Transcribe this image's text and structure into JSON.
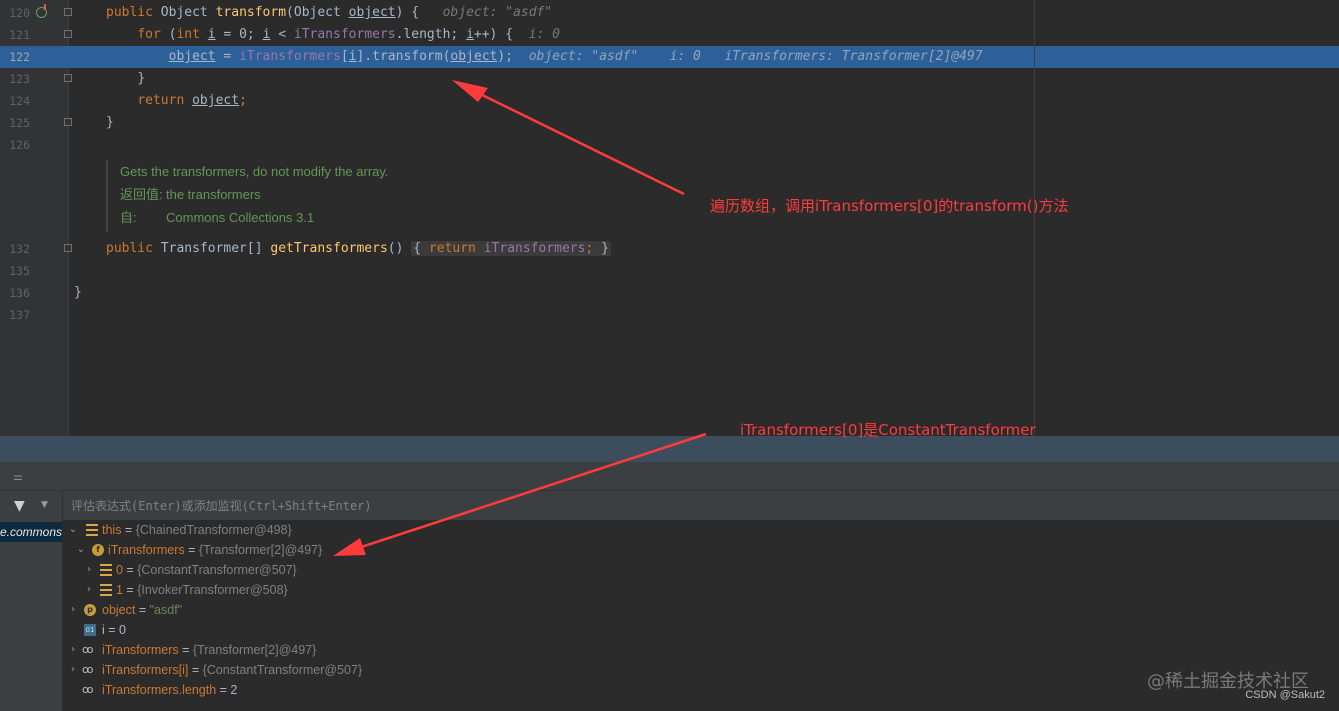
{
  "editor": {
    "lines": [
      {
        "num": "120",
        "cur": false
      },
      {
        "num": "121",
        "cur": false
      },
      {
        "num": "122",
        "cur": true
      },
      {
        "num": "123",
        "cur": false
      },
      {
        "num": "124",
        "cur": false
      },
      {
        "num": "125",
        "cur": false
      },
      {
        "num": "126",
        "cur": false
      },
      {
        "num": "132",
        "cur": false
      },
      {
        "num": "135",
        "cur": false
      },
      {
        "num": "136",
        "cur": false
      },
      {
        "num": "137",
        "cur": false
      }
    ],
    "l120": {
      "kw_public": "public",
      "type": " Object ",
      "fn": "transform",
      "p1": "(Object ",
      "param": "object",
      "p2": ") {",
      "hint": "object: \"asdf\""
    },
    "l121": {
      "kw_for": "for",
      "p1": " (",
      "kw_int": "int",
      "p2": " ",
      "i1": "i",
      "p3": " = 0; ",
      "i2": "i",
      "p4": " < ",
      "fld": "iTransformers",
      "p5": ".length; ",
      "i3": "i",
      "p6": "++) {",
      "hint": "i: 0"
    },
    "l122": {
      "obj": "object",
      "p1": " = ",
      "fld": "iTransformers",
      "p2": "[",
      "idx": "i",
      "p3": "].transform(",
      "arg": "object",
      "p4": ");",
      "hint1": "object: \"asdf\"",
      "hint2": "i: 0",
      "hint3": "iTransformers: Transformer[2]@497"
    },
    "l123": {
      "brace": "}"
    },
    "l124": {
      "kw_return": "return",
      "sp": " ",
      "obj": "object",
      "semi": ";"
    },
    "l125": {
      "brace": "}"
    },
    "doc": {
      "summary": "Gets the transformers, do not modify the array.",
      "returns_label": "返回值:",
      "returns_value": "the transformers",
      "since_label": "自:",
      "since_value": "Commons Collections 3.1"
    },
    "l132": {
      "kw_public": "public",
      "type": " Transformer[] ",
      "fn": "getTransformers",
      "p1": "() ",
      "fold_open": "{ ",
      "kw_return": "return",
      "sp": " ",
      "fld": "iTransformers",
      "semi": ";",
      "fold_close": " }"
    },
    "l136": {
      "brace": "}"
    }
  },
  "debugger": {
    "eval_placeholder": "评估表达式(Enter)或添加监视(Ctrl+Shift+Enter)",
    "frame_selected": "e.commons",
    "variables": [
      {
        "name": "this",
        "eq": " = ",
        "value": "{ChainedTransformer@498}"
      },
      {
        "name": "iTransformers",
        "eq": " = ",
        "value": "{Transformer[2]@497}"
      },
      {
        "name": "0",
        "eq": " = ",
        "value": "{ConstantTransformer@507}"
      },
      {
        "name": "1",
        "eq": " = ",
        "value": "{InvokerTransformer@508}"
      },
      {
        "name": "object",
        "eq": " = ",
        "value": "\"asdf\""
      },
      {
        "name": "i",
        "eq": " = ",
        "value": "0"
      },
      {
        "name": "iTransformers",
        "eq": " = ",
        "value": "{Transformer[2]@497}"
      },
      {
        "name": "iTransformers[i]",
        "eq": " = ",
        "value": "{ConstantTransformer@507}"
      },
      {
        "name": "iTransformers.length",
        "eq": " = ",
        "value": "2"
      }
    ]
  },
  "annotations": {
    "note1": "遍历数组，调用iTransformers[0]的transform()方法",
    "note2": "iTransformers[0]是ConstantTransformer"
  },
  "watermark": {
    "site": "@稀土掘金技术社区",
    "csdn": "CSDN @Sakut2"
  },
  "colors": {
    "annotation": "#ff3b3b",
    "selection": "#2d6099",
    "keyword": "#cc7832",
    "field": "#9876aa"
  }
}
